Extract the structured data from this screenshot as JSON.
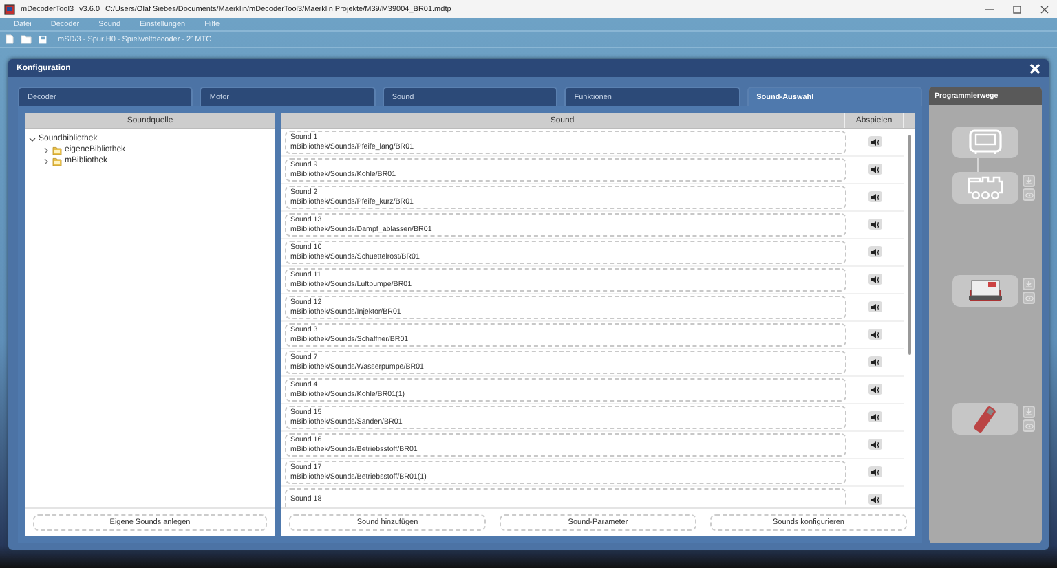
{
  "window": {
    "app_name": "mDecoderTool3",
    "version": "v3.6.0",
    "path": "C:/Users/Olaf Siebes/Documents/Maerklin/mDecoderTool3/Maerklin Projekte/M39/M39004_BR01.mdtp"
  },
  "menu": [
    "Datei",
    "Decoder",
    "Sound",
    "Einstellungen",
    "Hilfe"
  ],
  "toolbar": {
    "decoder_label": "mSD/3 - Spur H0 - Spielweltdecoder - 21MTC"
  },
  "dialog": {
    "title": "Konfiguration",
    "tabs": [
      {
        "label": "Decoder",
        "selected": false
      },
      {
        "label": "Motor",
        "selected": false
      },
      {
        "label": "Sound",
        "selected": false
      },
      {
        "label": "Funktionen",
        "selected": false
      },
      {
        "label": "Sound-Auswahl",
        "selected": true
      }
    ],
    "source": {
      "header": "Soundquelle",
      "tree": [
        {
          "label": "Soundbibliothek",
          "expanded": true,
          "children": [
            {
              "label": "eigeneBibliothek",
              "expanded": false
            },
            {
              "label": "mBibliothek",
              "expanded": false
            }
          ]
        }
      ],
      "button": "Eigene Sounds anlegen"
    },
    "sounds": {
      "columns": [
        "Sound",
        "Abspielen"
      ],
      "rows": [
        {
          "name": "Sound 1",
          "path": "mBibliothek/Sounds/Pfeife_lang/BR01"
        },
        {
          "name": "Sound 9",
          "path": "mBibliothek/Sounds/Kohle/BR01"
        },
        {
          "name": "Sound 2",
          "path": "mBibliothek/Sounds/Pfeife_kurz/BR01"
        },
        {
          "name": "Sound 13",
          "path": "mBibliothek/Sounds/Dampf_ablassen/BR01"
        },
        {
          "name": "Sound 10",
          "path": "mBibliothek/Sounds/Schuettelrost/BR01"
        },
        {
          "name": "Sound 11",
          "path": "mBibliothek/Sounds/Luftpumpe/BR01"
        },
        {
          "name": "Sound 12",
          "path": "mBibliothek/Sounds/Injektor/BR01"
        },
        {
          "name": "Sound 3",
          "path": "mBibliothek/Sounds/Schaffner/BR01"
        },
        {
          "name": "Sound 7",
          "path": "mBibliothek/Sounds/Wasserpumpe/BR01"
        },
        {
          "name": "Sound 4",
          "path": "mBibliothek/Sounds/Kohle/BR01(1)"
        },
        {
          "name": "Sound 15",
          "path": "mBibliothek/Sounds/Sanden/BR01"
        },
        {
          "name": "Sound 16",
          "path": "mBibliothek/Sounds/Betriebsstoff/BR01"
        },
        {
          "name": "Sound 17",
          "path": "mBibliothek/Sounds/Betriebsstoff/BR01(1)"
        },
        {
          "name": "Sound 18"
        }
      ],
      "buttons": [
        "Sound hinzufügen",
        "Sound-Parameter",
        "Sounds konfigurieren"
      ]
    },
    "programming": {
      "title": "Programmierwege",
      "nodes": [
        {
          "kind": "programmer"
        },
        {
          "kind": "locomotive"
        },
        {
          "kind": "decoder"
        },
        {
          "kind": "stick"
        }
      ]
    }
  }
}
